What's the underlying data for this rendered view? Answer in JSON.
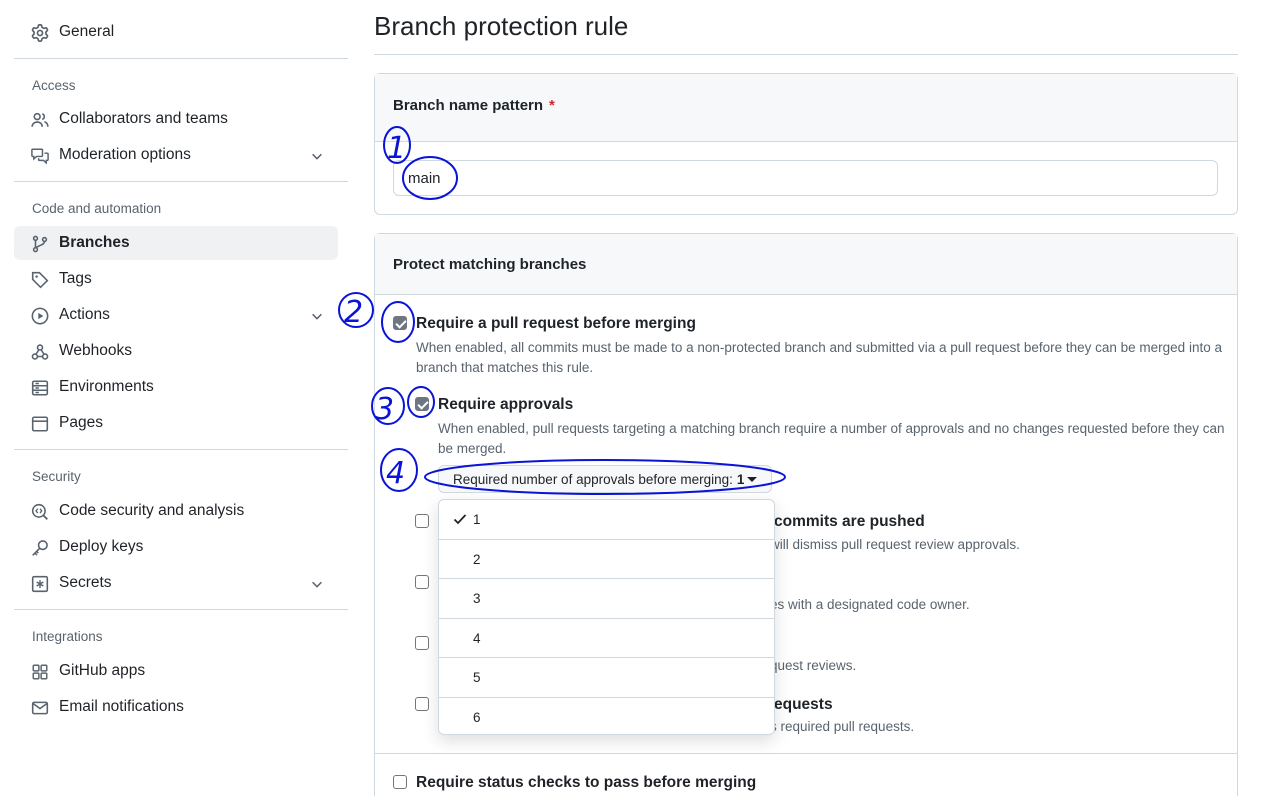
{
  "sidebar": {
    "general": "General",
    "sections": {
      "access": "Access",
      "code_automation": "Code and automation",
      "security": "Security",
      "integrations": "Integrations"
    },
    "items": {
      "collaborators": "Collaborators and teams",
      "moderation": "Moderation options",
      "branches": "Branches",
      "tags": "Tags",
      "actions": "Actions",
      "webhooks": "Webhooks",
      "environments": "Environments",
      "pages": "Pages",
      "code_security": "Code security and analysis",
      "deploy_keys": "Deploy keys",
      "secrets": "Secrets",
      "github_apps": "GitHub apps",
      "email_notifications": "Email notifications"
    },
    "active_item": "Branches"
  },
  "main": {
    "title": "Branch protection rule",
    "pattern_box": {
      "heading": "Branch name pattern",
      "required_marker": "*",
      "value": "main"
    },
    "protect_box": {
      "heading": "Protect matching branches",
      "options": {
        "require_pr": {
          "title": "Require a pull request before merging",
          "desc": "When enabled, all commits must be made to a non-protected branch and submitted via a pull request before they can be merged into a branch that matches this rule.",
          "checked": true
        },
        "require_approvals": {
          "title": "Require approvals",
          "desc": "When enabled, pull requests targeting a matching branch require a number of approvals and no changes requested before they can be merged.",
          "checked": true
        },
        "dismiss_stale": {
          "title_partial": "commits are pushed",
          "desc_partial": "will dismiss pull request review approvals.",
          "checked": false
        },
        "code_owners": {
          "desc_partial": "es with a designated code owner.",
          "checked": false
        },
        "restrict_dismiss": {
          "desc_partial": "quest reviews.",
          "checked": false
        },
        "bypass": {
          "title_partial": "equests",
          "desc_partial": "s required pull requests.",
          "checked": false
        },
        "status_checks": {
          "title": "Require status checks to pass before merging",
          "checked": false
        }
      },
      "approvals_select": {
        "label": "Required number of approvals before merging:",
        "value": "1",
        "options": [
          "1",
          "2",
          "3",
          "4",
          "5",
          "6"
        ],
        "selected_index": 0
      }
    }
  },
  "annotations": {
    "labels": [
      "1",
      "2",
      "3",
      "4"
    ],
    "color": "#0a14d6"
  }
}
